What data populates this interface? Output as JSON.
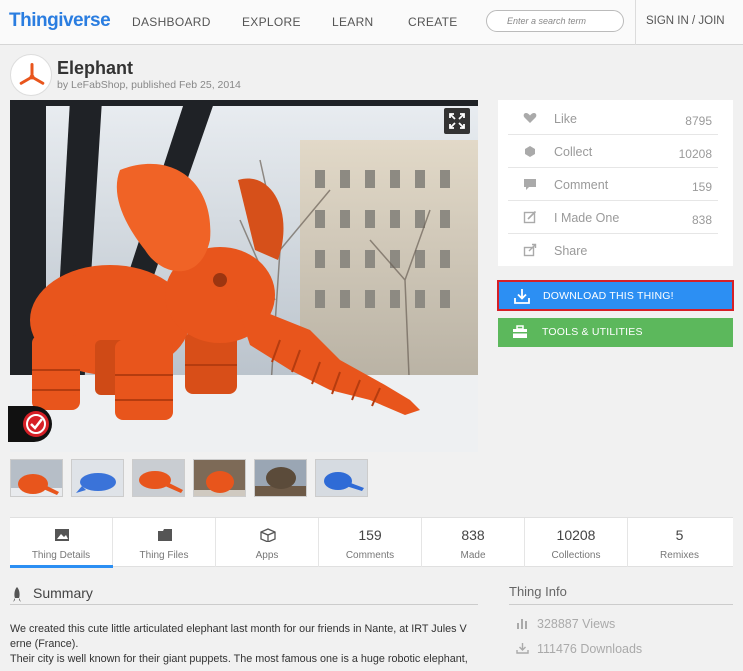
{
  "header": {
    "logo": "Thingiverse",
    "nav": [
      "DASHBOARD",
      "EXPLORE",
      "LEARN",
      "CREATE"
    ],
    "search_placeholder": "Enter a search term",
    "signin": "SIGN IN / JOIN"
  },
  "thing": {
    "title": "Elephant",
    "byline": "by LeFabShop, published Feb 25, 2014"
  },
  "actions": [
    {
      "label": "Like",
      "count": "8795",
      "icon": "heart-icon"
    },
    {
      "label": "Collect",
      "count": "10208",
      "icon": "collect-icon"
    },
    {
      "label": "Comment",
      "count": "159",
      "icon": "comment-icon"
    },
    {
      "label": "I Made One",
      "count": "838",
      "icon": "made-icon"
    },
    {
      "label": "Share",
      "count": "",
      "icon": "share-icon"
    }
  ],
  "buttons": {
    "download": "DOWNLOAD THIS THING!",
    "tools": "TOOLS & UTILITIES"
  },
  "tabs": [
    {
      "label": "Thing Details",
      "num": "",
      "icon": "image-icon"
    },
    {
      "label": "Thing Files",
      "num": "",
      "icon": "folder-icon"
    },
    {
      "label": "Apps",
      "num": "",
      "icon": "box-icon"
    },
    {
      "label": "Comments",
      "num": "159"
    },
    {
      "label": "Made",
      "num": "838"
    },
    {
      "label": "Collections",
      "num": "10208"
    },
    {
      "label": "Remixes",
      "num": "5"
    }
  ],
  "summary": {
    "heading": "Summary",
    "line1": "We created this cute little articulated elephant last month for our friends in Nante, at IRT Jules V",
    "line2": "erne (France).",
    "line3": "Their city is well known for their giant puppets. The most famous one is a huge robotic elephant,"
  },
  "info": {
    "heading": "Thing Info",
    "views": "328887 Views",
    "downloads": "111476 Downloads"
  },
  "colors": {
    "accent": "#2c8ff3",
    "elephant": "#e8551c",
    "tools": "#5cb85c",
    "highlight": "#d62027"
  }
}
